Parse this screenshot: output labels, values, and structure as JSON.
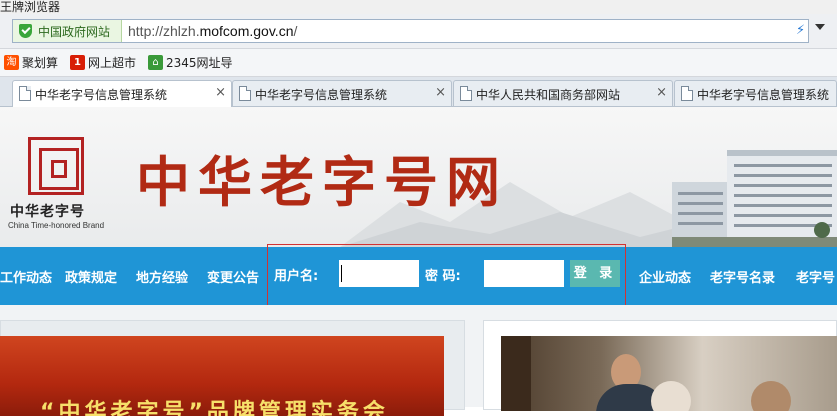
{
  "window": {
    "title": "王牌浏览器"
  },
  "address_bar": {
    "site_badge": "中国政府网站",
    "url_prefix": "http://zhlzh.",
    "url_domain": "mofcom.gov.cn",
    "url_suffix": "/"
  },
  "favorites": [
    {
      "label": "聚划算",
      "icon": "taobao-icon",
      "color": "#ff5000",
      "glyph": "淘"
    },
    {
      "label": "网上超市",
      "icon": "yihaodian-icon",
      "color": "#d81e06",
      "glyph": "1"
    },
    {
      "label": "2345网址导",
      "icon": "house-icon",
      "color": "#3a9a3a",
      "glyph": "⌂"
    }
  ],
  "tabs": [
    {
      "label": "中华老字号信息管理系统",
      "active": true
    },
    {
      "label": "中华老字号信息管理系统",
      "active": false
    },
    {
      "label": "中华人民共和国商务部网站",
      "active": false
    },
    {
      "label": "中华老字号信息管理系统",
      "active": false
    }
  ],
  "tab_close_glyph": "×",
  "site": {
    "logo_cn": "中华老字号",
    "logo_en": "China Time-honored Brand",
    "title": "中华老字号网"
  },
  "nav_left": [
    "工作动态",
    "政策规定",
    "地方经验",
    "变更公告"
  ],
  "login": {
    "username_label": "用户名:",
    "password_label": "密  码:",
    "username_value": "",
    "password_value": "",
    "submit_label": "登 录"
  },
  "nav_right": [
    "企业动态",
    "老字号名录",
    "老字号"
  ],
  "content": {
    "left_banner_text": "“中华老字号”品牌管理实务会"
  },
  "colors": {
    "nav_bg": "#1f95d6",
    "title_red": "#b12a14",
    "login_button": "#5ab8b0",
    "login_box_border": "#d23232"
  }
}
